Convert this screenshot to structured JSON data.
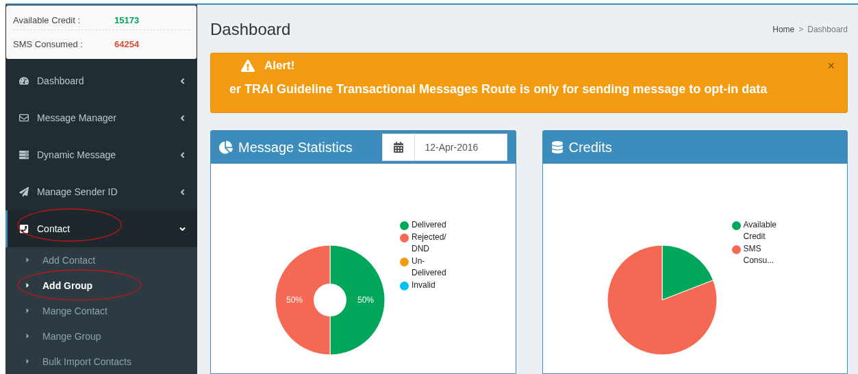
{
  "credit_summary": [
    {
      "label": "Available Credit :",
      "value": "15173",
      "color": "#00a65a"
    },
    {
      "label": "SMS Consumed :",
      "value": "64254",
      "color": "#dd4b39"
    }
  ],
  "sidebar": {
    "items": [
      {
        "kind": "dashboard",
        "label": "Dashboard",
        "selected": false,
        "expanded": false,
        "circled": false
      },
      {
        "kind": "envelope",
        "label": "Message Manager",
        "selected": false,
        "expanded": false,
        "circled": false
      },
      {
        "kind": "server",
        "label": "Dynamic Message",
        "selected": false,
        "expanded": false,
        "circled": false
      },
      {
        "kind": "plane",
        "label": "Manage Sender ID",
        "selected": false,
        "expanded": false,
        "circled": false
      },
      {
        "kind": "phone",
        "label": "Contact",
        "selected": true,
        "expanded": true,
        "circled": true,
        "children": [
          {
            "label": "Add Contact",
            "selected": false,
            "circled": false
          },
          {
            "label": "Add Group",
            "selected": true,
            "circled": true
          },
          {
            "label": "Mange Contact",
            "selected": false,
            "circled": false
          },
          {
            "label": "Mange Group",
            "selected": false,
            "circled": false
          },
          {
            "label": "Bulk Import Contacts",
            "selected": false,
            "circled": false
          }
        ]
      }
    ]
  },
  "page": {
    "title": "Dashboard",
    "breadcrumbs": [
      "Home",
      "Dashboard"
    ],
    "breadcrumb_separator": ">"
  },
  "alert": {
    "title": "Alert!",
    "message": "er TRAI Guideline Transactional Messages Route is only for sending message to opt-in data",
    "close": "×"
  },
  "panels": [
    {
      "kind": "stats",
      "title": "Message Statistics",
      "date": "12-Apr-2016",
      "chart_data": {
        "type": "donut",
        "categories": [
          "Delivered",
          "Rejected/ DND",
          "Un-Delivered",
          "Invalid"
        ],
        "series": [
          {
            "values": [
              50,
              50,
              0,
              0
            ]
          }
        ],
        "colors": [
          "#00a65a",
          "#f56954",
          "#f39c12",
          "#00c0ef"
        ],
        "value_labels": [
          "50%",
          "50%",
          null,
          null
        ]
      }
    },
    {
      "kind": "credits",
      "title": "Credits",
      "chart_data": {
        "type": "pie",
        "categories": [
          "Available Credit",
          "SMS Consu..."
        ],
        "series": [
          {
            "values": [
              19.1,
              80.9
            ]
          }
        ],
        "colors": [
          "#00a65a",
          "#f56954"
        ]
      }
    }
  ]
}
